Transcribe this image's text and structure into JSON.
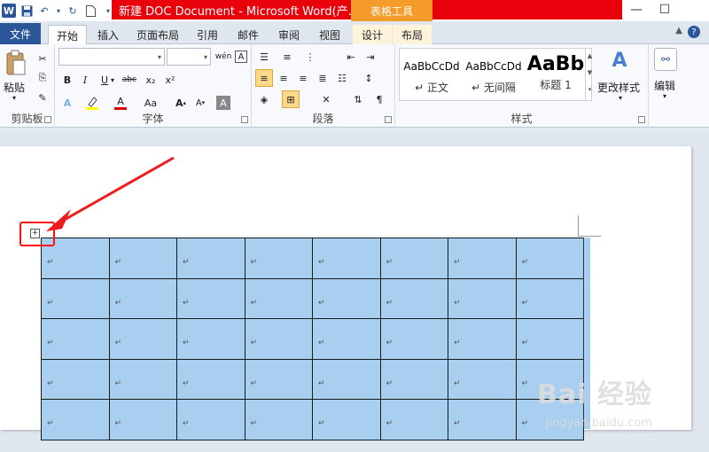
{
  "title_bar": {
    "app_icon": "W",
    "title": "新建 DOC Document - Microsoft Word(产...",
    "contextual_group": "表格工具",
    "minimize_glyph": "—",
    "maximize_glyph": "☐",
    "accent_red": "#e8000b",
    "accent_orange": "#f59b2a"
  },
  "tabs": [
    {
      "label": "文件"
    },
    {
      "label": "开始"
    },
    {
      "label": "插入"
    },
    {
      "label": "页面布局"
    },
    {
      "label": "引用"
    },
    {
      "label": "邮件"
    },
    {
      "label": "审阅"
    },
    {
      "label": "视图"
    },
    {
      "label": "设计"
    },
    {
      "label": "布局"
    }
  ],
  "ribbon": {
    "clipboard": {
      "paste_label": "粘贴",
      "group_label": "剪贴板"
    },
    "font": {
      "group_label": "字体",
      "bold": "B",
      "italic": "I",
      "underline": "U",
      "strike": "abc",
      "sub": "x₂",
      "sup": "x²",
      "grow": "A",
      "shrink": "Aa",
      "font_color": "A",
      "clear": "A"
    },
    "paragraph": {
      "group_label": "段落"
    },
    "styles": {
      "group_label": "样式",
      "items": [
        {
          "sample": "AaBbCcDd",
          "name": "↵ 正文"
        },
        {
          "sample": "AaBbCcDd",
          "name": "↵ 无间隔"
        },
        {
          "sample": "AaBb",
          "name": "标题 1"
        }
      ],
      "change_styles": "更改样式"
    },
    "editing": {
      "label": "编辑"
    }
  },
  "table": {
    "cell_mark": "↵",
    "rows": 5,
    "cols": 8,
    "selection_color": "#a8cff0"
  },
  "watermark": {
    "main": "Bai 经验",
    "sub": "jingyan.baidu.com"
  }
}
